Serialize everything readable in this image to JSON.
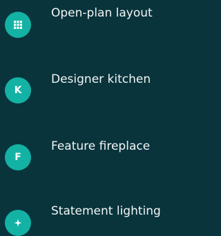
{
  "accent_color": "#13b2a4",
  "background_color": "#09343c",
  "features": [
    {
      "icon": "floorplan-grid-icon",
      "badge_text": "",
      "label": "Open-plan layout"
    },
    {
      "icon": "letter-k-icon",
      "badge_text": "K",
      "label": "Designer kitchen"
    },
    {
      "icon": "letter-f-icon",
      "badge_text": "F",
      "label": "Feature fireplace"
    },
    {
      "icon": "sparkle-icon",
      "badge_text": "",
      "label": "Statement lighting"
    }
  ]
}
